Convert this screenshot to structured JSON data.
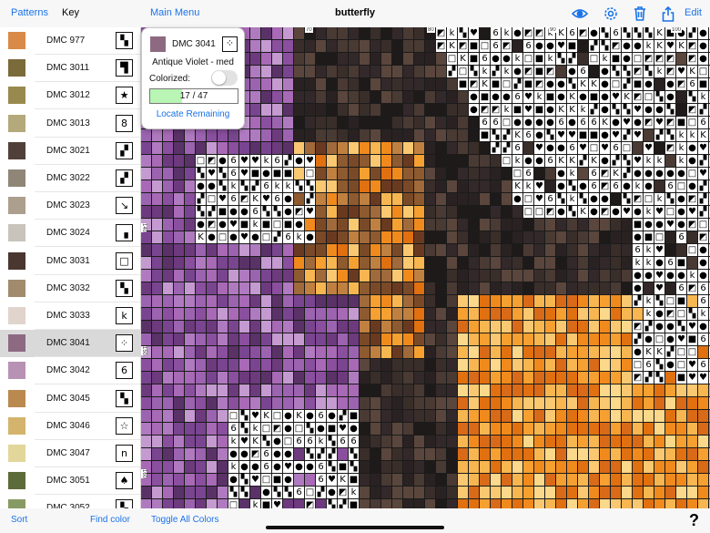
{
  "toolbar": {
    "patterns_label": "Patterns",
    "key_label": "Key",
    "main_menu_label": "Main Menu",
    "title": "butterfly",
    "edit_label": "Edit",
    "icons": [
      "eye-icon",
      "gear-icon",
      "trash-icon",
      "share-icon"
    ]
  },
  "key_list": [
    {
      "label": "DMC 977",
      "color": "#d98a48",
      "symbol": "▚"
    },
    {
      "label": "DMC 3011",
      "color": "#7b6a3a",
      "symbol": "▜"
    },
    {
      "label": "DMC 3012",
      "color": "#988a4f",
      "symbol": "★"
    },
    {
      "label": "DMC 3013",
      "color": "#b3a97b",
      "symbol": "8"
    },
    {
      "label": "DMC 3021",
      "color": "#51403a",
      "symbol": "▞"
    },
    {
      "label": "DMC 3022",
      "color": "#8f8678",
      "symbol": "▞"
    },
    {
      "label": "DMC 3023",
      "color": "#ad9f8e",
      "symbol": "↘"
    },
    {
      "label": "DMC 3024",
      "color": "#c8c3bb",
      "symbol": "▗"
    },
    {
      "label": "DMC 3031",
      "color": "#4a3730",
      "symbol": "□"
    },
    {
      "label": "DMC 3032",
      "color": "#a28a6c",
      "symbol": "▚"
    },
    {
      "label": "DMC 3033",
      "color": "#e1d4cc",
      "symbol": "k"
    },
    {
      "label": "DMC 3041",
      "color": "#8d6a82",
      "symbol": "⁘",
      "selected": true
    },
    {
      "label": "DMC 3042",
      "color": "#b892b4",
      "symbol": "6"
    },
    {
      "label": "DMC 3045",
      "color": "#b9894f",
      "symbol": "▚"
    },
    {
      "label": "DMC 3046",
      "color": "#d4b46c",
      "symbol": "☆"
    },
    {
      "label": "DMC 3047",
      "color": "#e3d69a",
      "symbol": "n"
    },
    {
      "label": "DMC 3051",
      "color": "#5d6a3a",
      "symbol": "♠"
    },
    {
      "label": "DMC 3052",
      "color": "#889a64",
      "symbol": "▚"
    }
  ],
  "popup": {
    "code": "DMC 3041",
    "color": "#8d6a82",
    "symbol": "⁘",
    "description": "Antique Violet - med",
    "colorized_label": "Colorized:",
    "colorized": false,
    "progress_text": "17 / 47",
    "progress_done": 17,
    "progress_total": 47,
    "locate_label": "Locate Remaining"
  },
  "grid": {
    "col_markers": [
      "70",
      "80",
      "90",
      "100"
    ],
    "row_markers": [
      "140",
      "150",
      "160"
    ]
  },
  "bottom": {
    "sort_label": "Sort",
    "find_color_label": "Find color",
    "toggle_all_label": "Toggle All Colors",
    "help_label": "?"
  }
}
